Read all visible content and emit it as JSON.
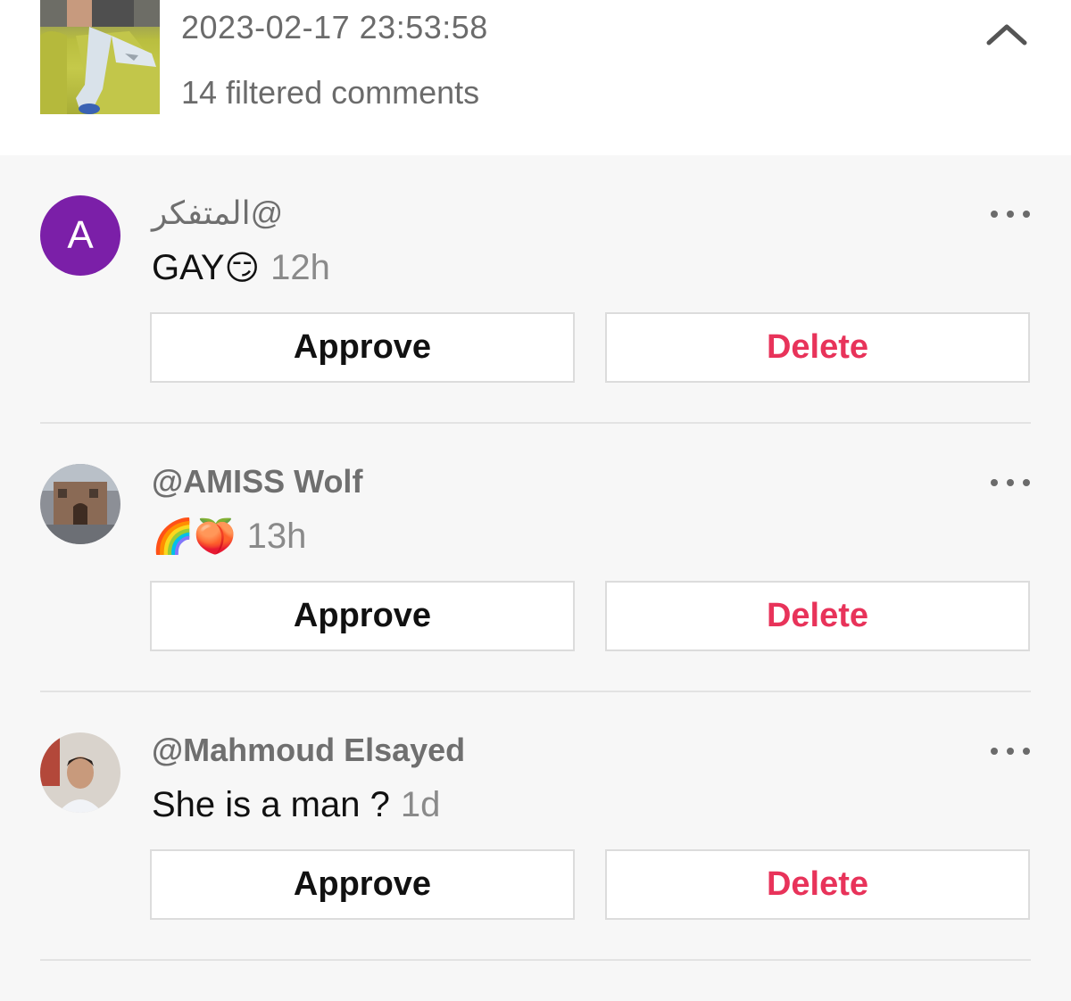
{
  "header": {
    "date": "2023-02-17 23:53:58",
    "filtered_count": "14 filtered comments",
    "collapse_icon": "chevron-up-icon"
  },
  "comments": [
    {
      "avatar_type": "letter",
      "avatar_letter": "A",
      "avatar_color": "#7b1fa8",
      "username": "@المتفكر",
      "text": "GAY",
      "emoji": "😏",
      "time": "12h",
      "approve_label": "Approve",
      "delete_label": "Delete"
    },
    {
      "avatar_type": "photo",
      "username": "@AMISS Wolf",
      "text": "",
      "emoji": "🌈🍑",
      "time": "13h",
      "approve_label": "Approve",
      "delete_label": "Delete"
    },
    {
      "avatar_type": "photo",
      "username": "@Mahmoud Elsayed",
      "text": "She is a man ?",
      "emoji": "",
      "time": "1d",
      "approve_label": "Approve",
      "delete_label": "Delete"
    }
  ],
  "colors": {
    "delete": "#e8335a",
    "muted_text": "#6b6b6b",
    "background": "#f7f7f7"
  }
}
